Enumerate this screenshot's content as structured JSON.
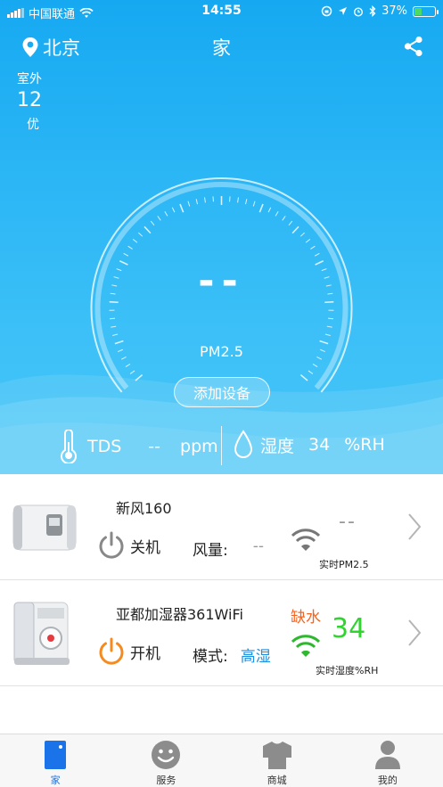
{
  "status_bar": {
    "carrier": "中国联通",
    "time": "14:55",
    "battery": "37%",
    "battery_level": 0.37
  },
  "header": {
    "city": "北京",
    "title": "家"
  },
  "outdoor": {
    "label": "室外",
    "value": "12",
    "quality": "优"
  },
  "gauge": {
    "value": "--",
    "label": "PM2.5",
    "add_button": "添加设备"
  },
  "readings": {
    "tds_label": "TDS",
    "tds_value": "--",
    "tds_unit": "ppm",
    "humidity_label": "湿度",
    "humidity_value": "34",
    "humidity_unit": "%RH"
  },
  "devices": [
    {
      "name": "新风160",
      "power_label": "关机",
      "mode_label": "风量:",
      "mode_value": "--",
      "metric_value": "--",
      "metric_caption": "实时PM2.5",
      "power_color": "#888888",
      "wifi_color": "#777777"
    },
    {
      "name": "亚都加湿器361WiFi",
      "power_label": "开机",
      "mode_label": "模式:",
      "mode_value": "高湿",
      "status": "缺水",
      "metric_value": "34",
      "metric_caption": "实时湿度%RH",
      "power_color": "#f58a1f",
      "wifi_color": "#2db82d",
      "status_color": "#f26522",
      "metric_color": "#2fd42f",
      "mode_value_color": "#1e90e0"
    }
  ],
  "tabs": [
    {
      "label": "家",
      "icon": "home-card-icon",
      "active": true
    },
    {
      "label": "服务",
      "icon": "smiley-icon",
      "active": false
    },
    {
      "label": "商城",
      "icon": "shirt-icon",
      "active": false
    },
    {
      "label": "我的",
      "icon": "person-icon",
      "active": false
    }
  ]
}
